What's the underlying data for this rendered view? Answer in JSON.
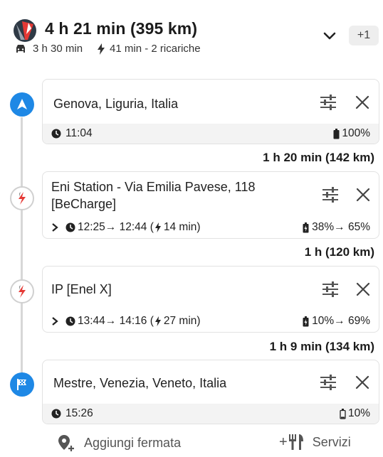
{
  "header": {
    "title": "4 h 21 min (395 km)",
    "drive_time": "3 h 30 min",
    "charge_info": "41 min - 2 ricariche",
    "more_count": "+1"
  },
  "stops": [
    {
      "name": "Genova, Liguria, Italia",
      "time": "11:04",
      "battery": "100%"
    },
    {
      "name": "Eni Station - Via Emilia Pavese, 118 [BeCharge]",
      "time": "12:25→ 12:44 (",
      "charge_duration": "14 min)",
      "battery": "38%→ 65%"
    },
    {
      "name": "IP [Enel X]",
      "time": "13:44→ 14:16 (",
      "charge_duration": "27 min)",
      "battery": "10%→ 69%"
    },
    {
      "name": "Mestre, Venezia, Veneto, Italia",
      "time": "15:26",
      "battery": "10%"
    }
  ],
  "legs": [
    "1 h 20 min (142 km)",
    "1 h (120 km)",
    "1 h 9 min (134 km)"
  ],
  "bottom": {
    "add_stop": "Aggiungi fermata",
    "services": "Servizi"
  },
  "colors": {
    "accent_blue": "#1e88e5",
    "brand_red": "#e53935",
    "brand_gray": "#8a8a8a"
  },
  "icons": [
    "logo-icon",
    "car-icon",
    "bolt-icon",
    "chevron-down-icon",
    "navigation-arrow-icon",
    "charger-icon",
    "flag-icon",
    "settings-sliders-icon",
    "close-icon",
    "clock-icon",
    "battery-icon",
    "expand-chevron-icon",
    "add-location-icon",
    "restaurant-icon"
  ]
}
